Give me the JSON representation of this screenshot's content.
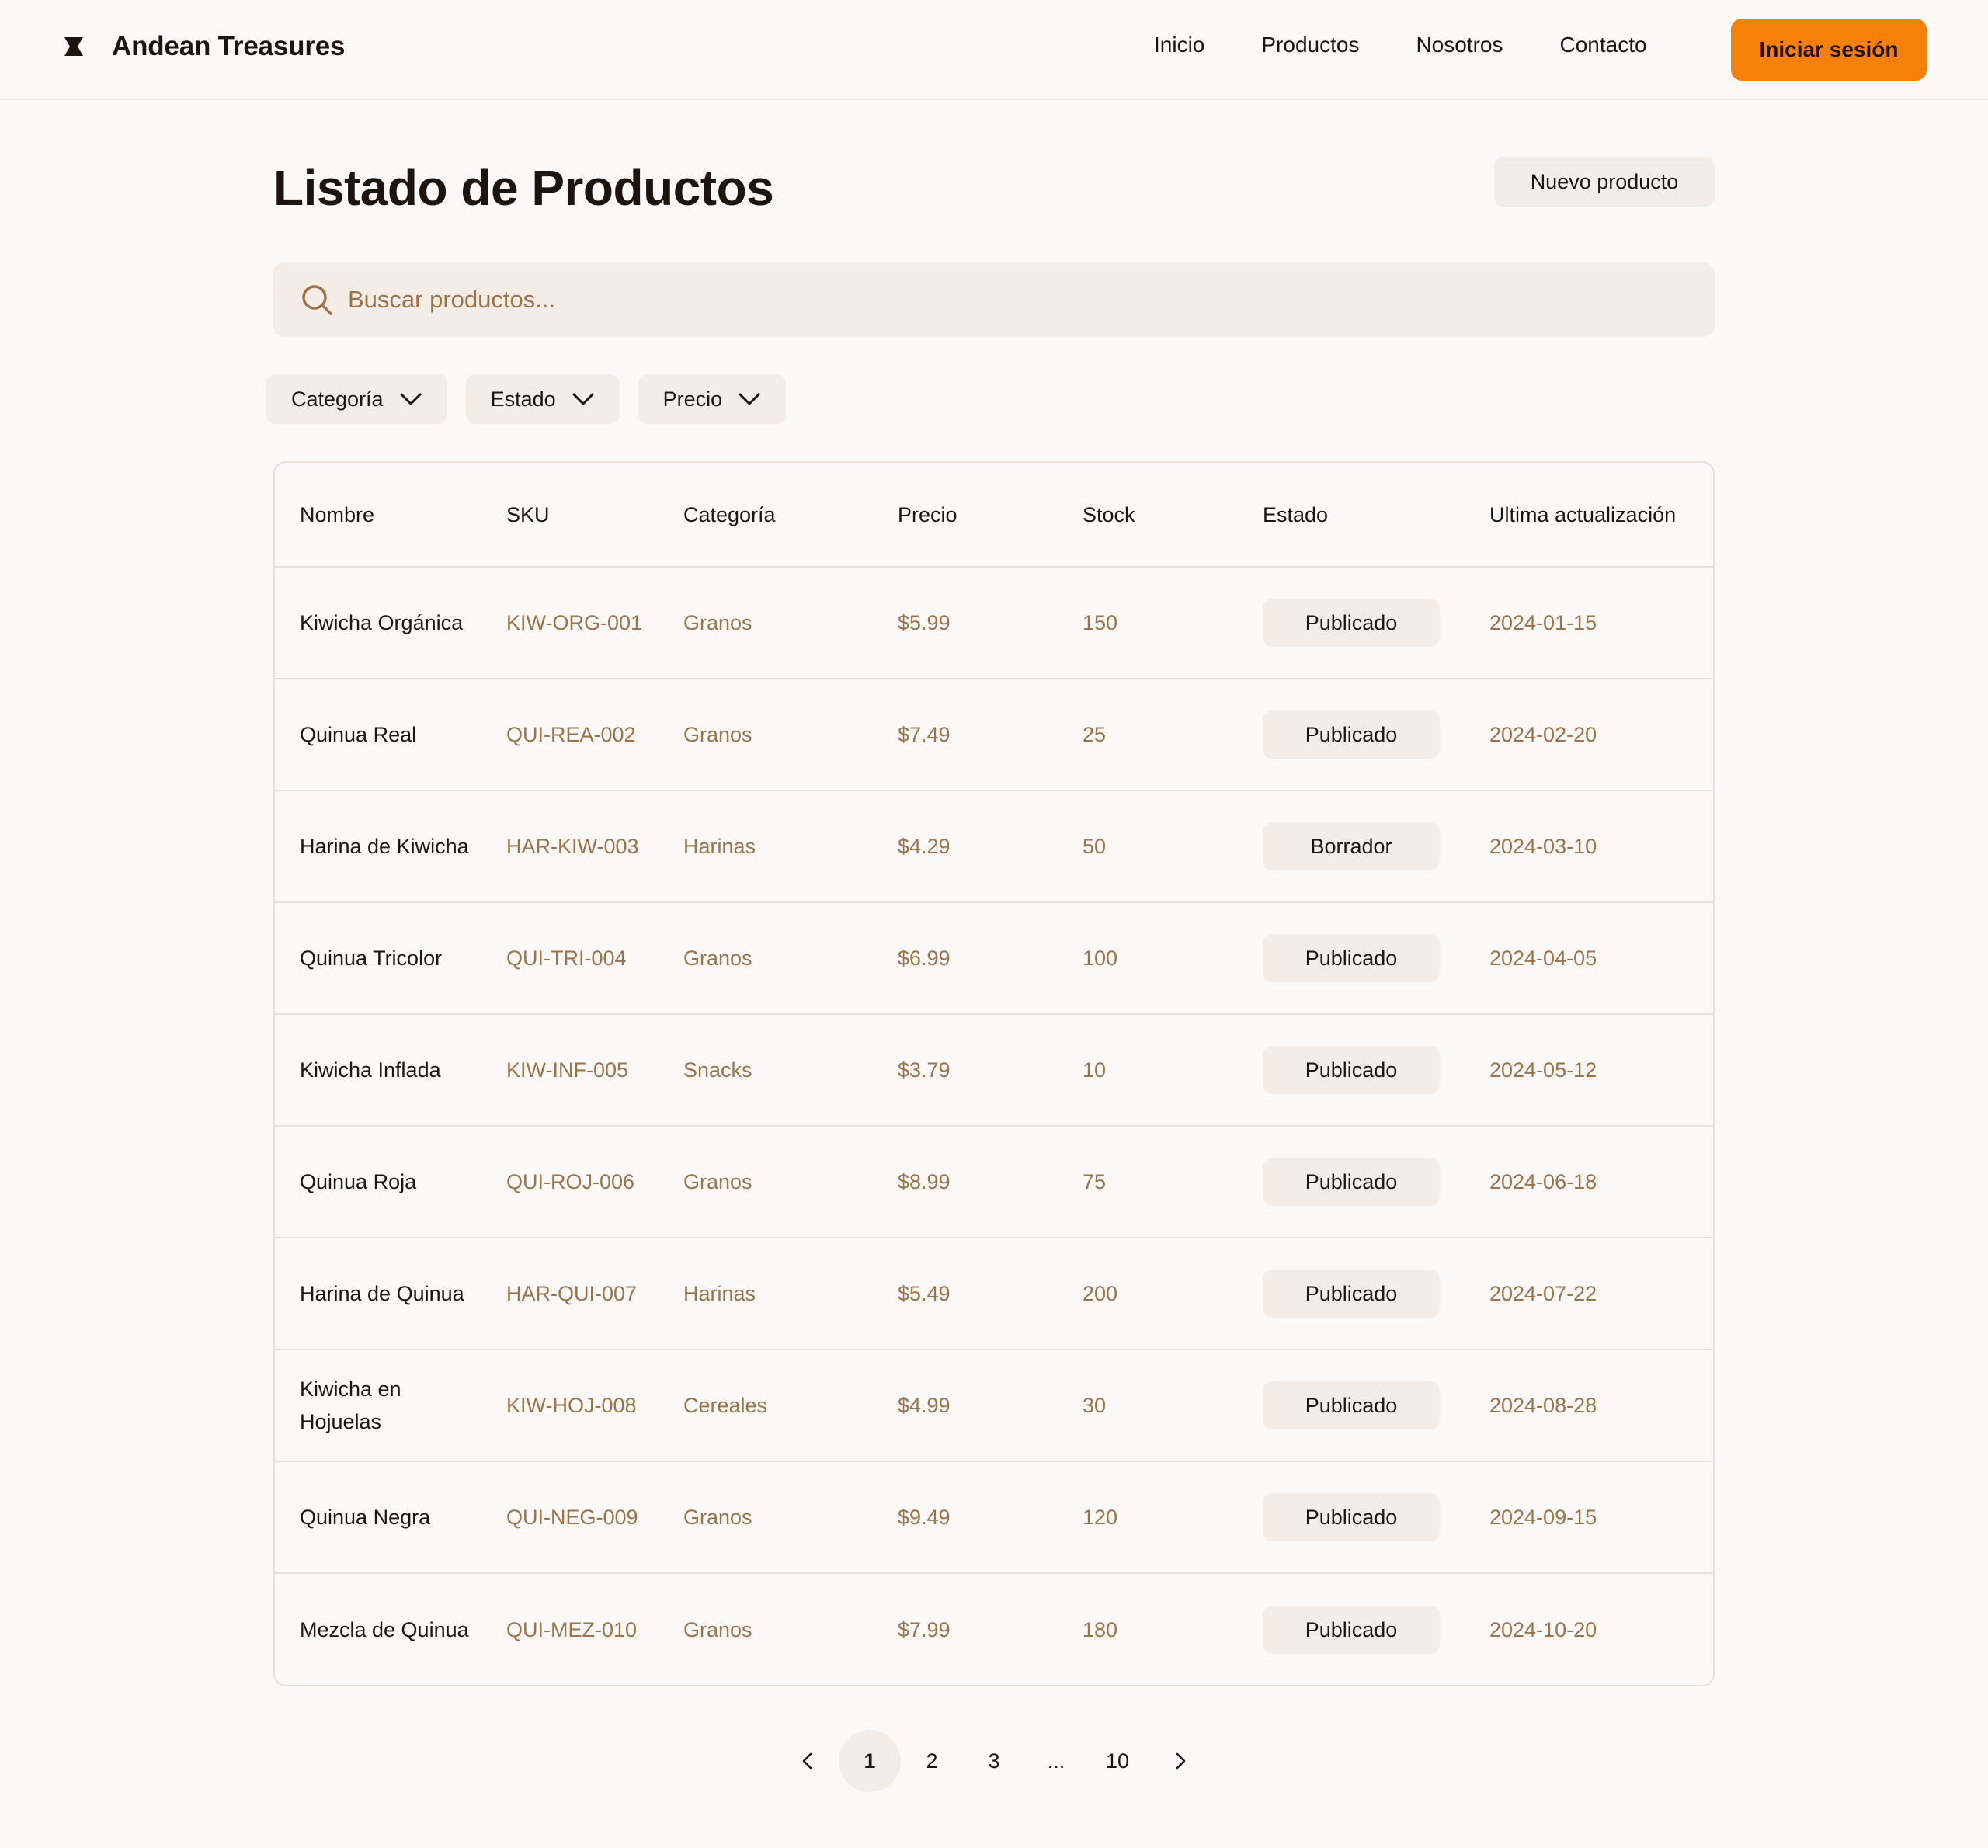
{
  "header": {
    "brand": "Andean Treasures",
    "nav": [
      "Inicio",
      "Productos",
      "Nosotros",
      "Contacto"
    ],
    "login": "Iniciar sesión"
  },
  "page": {
    "title": "Listado de Productos",
    "new_button": "Nuevo producto"
  },
  "search": {
    "placeholder": "Buscar productos...",
    "value": ""
  },
  "filters": [
    "Categoría",
    "Estado",
    "Precio"
  ],
  "table": {
    "columns": [
      "Nombre",
      "SKU",
      "Categoría",
      "Precio",
      "Stock",
      "Estado",
      "Ultima actualización"
    ],
    "rows": [
      [
        "Kiwicha Orgánica",
        "KIW-ORG-001",
        "Granos",
        "$5.99",
        "150",
        "Publicado",
        "2024-01-15"
      ],
      [
        "Quinua Real",
        "QUI-REA-002",
        "Granos",
        "$7.49",
        "25",
        "Publicado",
        "2024-02-20"
      ],
      [
        "Harina de Kiwicha",
        "HAR-KIW-003",
        "Harinas",
        "$4.29",
        "50",
        "Borrador",
        "2024-03-10"
      ],
      [
        "Quinua Tricolor",
        "QUI-TRI-004",
        "Granos",
        "$6.99",
        "100",
        "Publicado",
        "2024-04-05"
      ],
      [
        "Kiwicha Inflada",
        "KIW-INF-005",
        "Snacks",
        "$3.79",
        "10",
        "Publicado",
        "2024-05-12"
      ],
      [
        "Quinua Roja",
        "QUI-ROJ-006",
        "Granos",
        "$8.99",
        "75",
        "Publicado",
        "2024-06-18"
      ],
      [
        "Harina de Quinua",
        "HAR-QUI-007",
        "Harinas",
        "$5.49",
        "200",
        "Publicado",
        "2024-07-22"
      ],
      [
        "Kiwicha en Hojuelas",
        "KIW-HOJ-008",
        "Cereales",
        "$4.99",
        "30",
        "Publicado",
        "2024-08-28"
      ],
      [
        "Quinua Negra",
        "QUI-NEG-009",
        "Granos",
        "$9.49",
        "120",
        "Publicado",
        "2024-09-15"
      ],
      [
        "Mezcla de Quinua",
        "QUI-MEZ-010",
        "Granos",
        "$7.99",
        "180",
        "Publicado",
        "2024-10-20"
      ]
    ]
  },
  "pagination": {
    "pages": [
      "1",
      "2",
      "3",
      "...",
      "10"
    ],
    "active": "1"
  },
  "colors": {
    "accent": "#f78009",
    "muted_text": "#9c7349",
    "chip_bg": "#f4ede7",
    "border": "#e8dfd6"
  },
  "icons": [
    "brand-logo-icon",
    "search-icon",
    "chevron-down-icon",
    "chevron-left-icon",
    "chevron-right-icon"
  ]
}
